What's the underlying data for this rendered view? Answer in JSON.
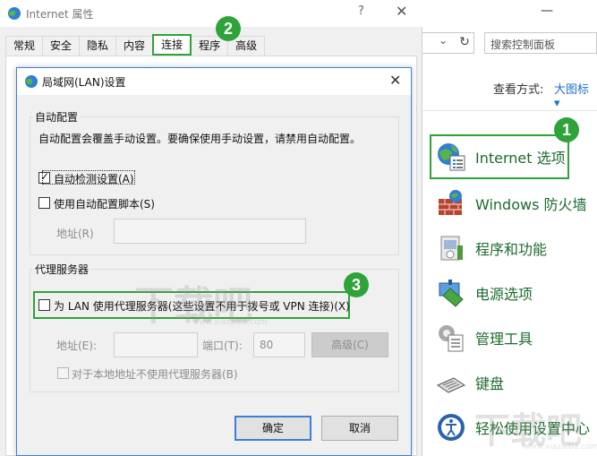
{
  "control_panel": {
    "search_placeholder": "搜索控制面板",
    "view_by_label": "查看方式:",
    "view_by_value": "大图标 ▾",
    "items": [
      {
        "label": "Internet 选项",
        "icon": "internet-options-icon"
      },
      {
        "label": "Windows 防火墙",
        "icon": "firewall-icon"
      },
      {
        "label": "程序和功能",
        "icon": "programs-features-icon"
      },
      {
        "label": "电源选项",
        "icon": "power-options-icon"
      },
      {
        "label": "管理工具",
        "icon": "admin-tools-icon"
      },
      {
        "label": "键盘",
        "icon": "keyboard-icon"
      },
      {
        "label": "轻松使用设置中心",
        "icon": "ease-of-access-icon"
      }
    ]
  },
  "internet_properties": {
    "title": "Internet 属性",
    "help": "?",
    "close": "✕",
    "tabs": [
      "常规",
      "安全",
      "隐私",
      "内容",
      "连接",
      "程序",
      "高级"
    ],
    "active_tab": "连接"
  },
  "lan_dialog": {
    "title": "局域网(LAN)设置",
    "close": "✕",
    "auto_config": {
      "group_label": "自动配置",
      "description": "自动配置会覆盖手动设置。要确保使用手动设置，请禁用自动配置。",
      "auto_detect_label": "自动检测设置(A)",
      "auto_detect_checked": true,
      "use_script_label": "使用自动配置脚本(S)",
      "use_script_checked": false,
      "address_label": "地址(R)",
      "address_value": ""
    },
    "proxy": {
      "group_label": "代理服务器",
      "use_proxy_label": "为 LAN 使用代理服务器(这些设置不用于拨号或 VPN 连接)(X)",
      "use_proxy_checked": false,
      "address_label": "地址(E):",
      "address_value": "",
      "port_label": "端口(T):",
      "port_value": "80",
      "advanced_label": "高级(C)",
      "bypass_local_label": "对于本地地址不使用代理服务器(B)",
      "bypass_local_checked": false
    },
    "ok_label": "确定",
    "cancel_label": "取消"
  },
  "annotations": {
    "badge_1": "1",
    "badge_2": "2",
    "badge_3": "3",
    "highlight_color": "#2ea33a"
  },
  "watermark": {
    "text": "下载吧",
    "url": "www.xiazaiba.com"
  }
}
